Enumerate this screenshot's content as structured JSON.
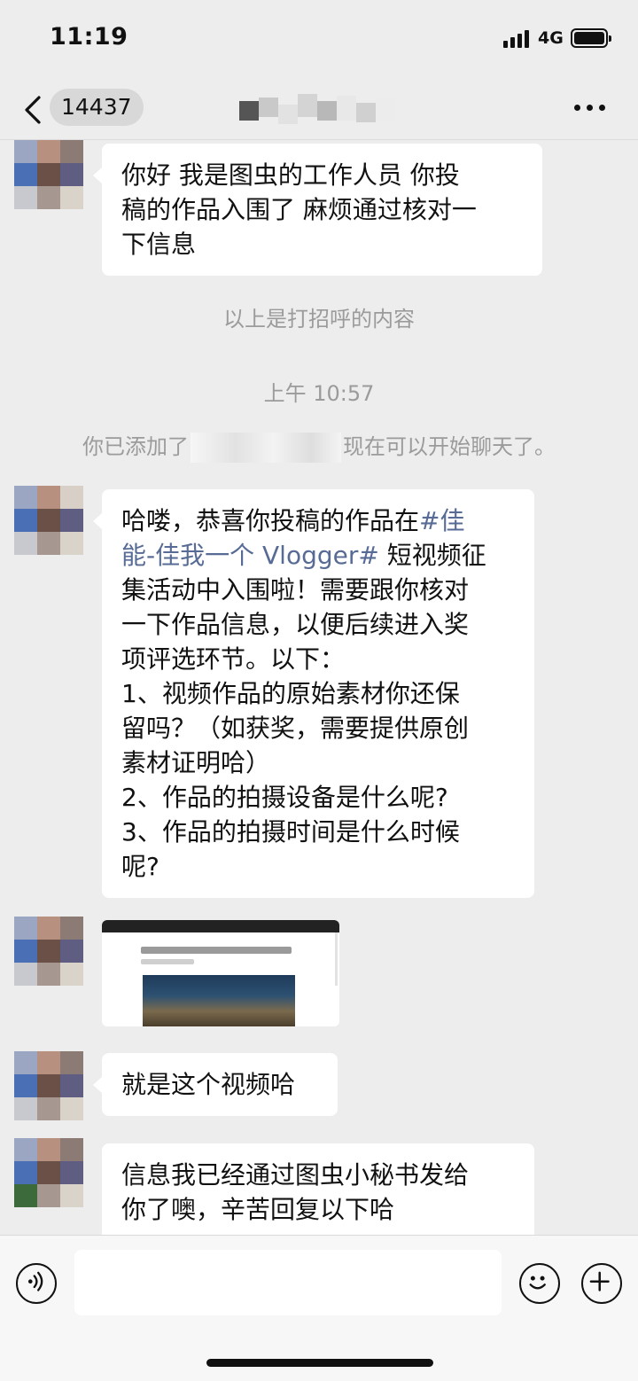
{
  "status_bar": {
    "time": "11:19",
    "network": "4G"
  },
  "nav": {
    "unread_count": "14437"
  },
  "messages": {
    "m1": [
      "你好 我是图虫的工作人员 你投",
      "稿的作品入围了 麻烦通过核对一",
      "下信息"
    ],
    "greeting_note": "以上是打招呼的内容",
    "timestamp": "上午 10:57",
    "added_prefix": "你已添加了",
    "added_suffix": "现在可以开始聊天了。",
    "m2_first_prefix": "哈喽，恭喜你投稿的作品在",
    "m2_hashtag_part1": "#佳",
    "m2_hashtag_part2": "能-佳我一个 Vlogger#",
    "m2_second_suffix": " 短视频征",
    "m2_rest": [
      "集活动中入围啦！需要跟你核对",
      "一下作品信息，以便后续进入奖",
      "项评选环节。以下：",
      "1、视频作品的原始素材你还保",
      "留吗？（如获奖，需要提供原创",
      "素材证明哈）",
      "2、作品的拍摄设备是什么呢?",
      "3、作品的拍摄时间是什么时候",
      "呢?"
    ],
    "m4": "就是这个视频哈",
    "m5": [
      "信息我已经通过图虫小秘书发给",
      "你了噢，辛苦回复以下哈"
    ]
  },
  "icons": {
    "back": "chevron-left-icon",
    "more": "more-dots-icon",
    "voice": "voice-icon",
    "emoji": "emoji-icon",
    "plus": "plus-icon"
  },
  "colors": {
    "background": "#ededed",
    "bubble": "#ffffff",
    "hashtag": "#576b95",
    "system_text": "#9b9b9b"
  }
}
